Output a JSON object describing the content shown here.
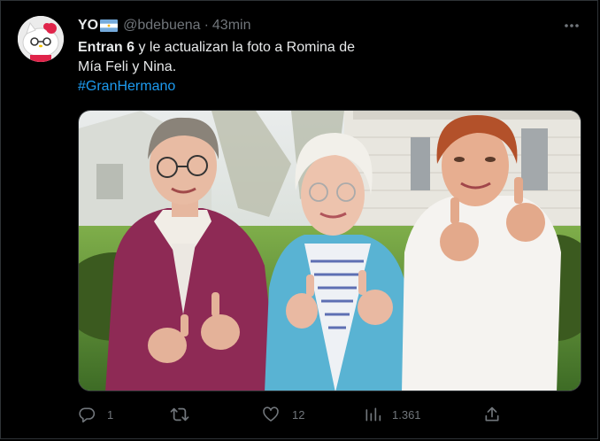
{
  "tweet": {
    "display_name": "YO",
    "handle": "@bdebuena",
    "separator": "·",
    "time": "43min",
    "text_bold": "Entran 6",
    "text_line1_rest": " y le actualizan la foto a Romina de",
    "text_line2": "Mía Feli y Nina.",
    "hashtag": "#GranHermano"
  },
  "actions": {
    "reply_count": "1",
    "retweet_count": "",
    "like_count": "12",
    "views_count": "1.361"
  },
  "icons": {
    "more": "more-horizontal-icon",
    "reply": "reply-icon",
    "retweet": "retweet-icon",
    "like": "heart-icon",
    "views": "views-chart-icon",
    "share": "share-icon",
    "flag": "argentina-flag-icon"
  },
  "colors": {
    "background": "#000000",
    "text": "#e7e9ea",
    "secondary_text": "#71767b",
    "link": "#1d9bf0",
    "border": "#2f3336"
  }
}
